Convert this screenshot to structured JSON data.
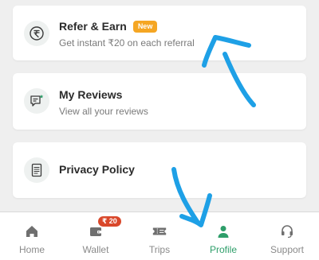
{
  "cards": {
    "refer": {
      "title": "Refer & Earn",
      "badge": "New",
      "subtitle": "Get instant ₹20 on each referral",
      "icon": "rupee-icon"
    },
    "reviews": {
      "title": "My Reviews",
      "subtitle": "View all your reviews",
      "icon": "review-icon"
    },
    "privacy": {
      "title": "Privacy Policy",
      "icon": "document-icon"
    }
  },
  "bottom_nav": {
    "items": [
      {
        "label": "Home",
        "icon": "home-icon",
        "active": false
      },
      {
        "label": "Wallet",
        "icon": "wallet-icon",
        "active": false,
        "badge": "₹ 20"
      },
      {
        "label": "Trips",
        "icon": "ticket-icon",
        "active": false
      },
      {
        "label": "Profile",
        "icon": "profile-icon",
        "active": true
      },
      {
        "label": "Support",
        "icon": "headset-icon",
        "active": false
      }
    ]
  },
  "colors": {
    "accent": "#2e9e6a",
    "badge_new": "#f5a623",
    "badge_wallet": "#d9482b",
    "annotation": "#1ea0e6"
  }
}
